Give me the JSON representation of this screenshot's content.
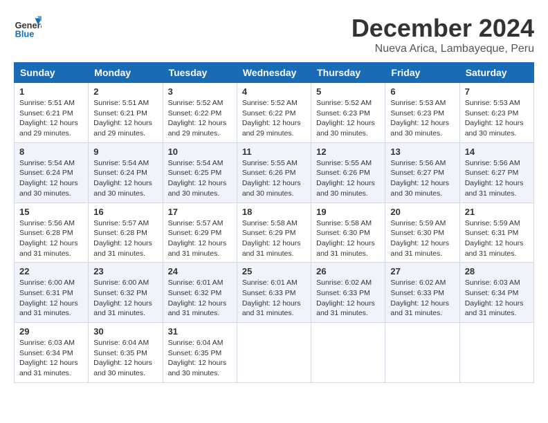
{
  "header": {
    "logo_line1": "General",
    "logo_line2": "Blue",
    "month": "December 2024",
    "location": "Nueva Arica, Lambayeque, Peru"
  },
  "days_of_week": [
    "Sunday",
    "Monday",
    "Tuesday",
    "Wednesday",
    "Thursday",
    "Friday",
    "Saturday"
  ],
  "weeks": [
    [
      {
        "day": 1,
        "sunrise": "5:51 AM",
        "sunset": "6:21 PM",
        "daylight": "12 hours and 29 minutes."
      },
      {
        "day": 2,
        "sunrise": "5:51 AM",
        "sunset": "6:21 PM",
        "daylight": "12 hours and 29 minutes."
      },
      {
        "day": 3,
        "sunrise": "5:52 AM",
        "sunset": "6:22 PM",
        "daylight": "12 hours and 29 minutes."
      },
      {
        "day": 4,
        "sunrise": "5:52 AM",
        "sunset": "6:22 PM",
        "daylight": "12 hours and 29 minutes."
      },
      {
        "day": 5,
        "sunrise": "5:52 AM",
        "sunset": "6:23 PM",
        "daylight": "12 hours and 30 minutes."
      },
      {
        "day": 6,
        "sunrise": "5:53 AM",
        "sunset": "6:23 PM",
        "daylight": "12 hours and 30 minutes."
      },
      {
        "day": 7,
        "sunrise": "5:53 AM",
        "sunset": "6:23 PM",
        "daylight": "12 hours and 30 minutes."
      }
    ],
    [
      {
        "day": 8,
        "sunrise": "5:54 AM",
        "sunset": "6:24 PM",
        "daylight": "12 hours and 30 minutes."
      },
      {
        "day": 9,
        "sunrise": "5:54 AM",
        "sunset": "6:24 PM",
        "daylight": "12 hours and 30 minutes."
      },
      {
        "day": 10,
        "sunrise": "5:54 AM",
        "sunset": "6:25 PM",
        "daylight": "12 hours and 30 minutes."
      },
      {
        "day": 11,
        "sunrise": "5:55 AM",
        "sunset": "6:26 PM",
        "daylight": "12 hours and 30 minutes."
      },
      {
        "day": 12,
        "sunrise": "5:55 AM",
        "sunset": "6:26 PM",
        "daylight": "12 hours and 30 minutes."
      },
      {
        "day": 13,
        "sunrise": "5:56 AM",
        "sunset": "6:27 PM",
        "daylight": "12 hours and 30 minutes."
      },
      {
        "day": 14,
        "sunrise": "5:56 AM",
        "sunset": "6:27 PM",
        "daylight": "12 hours and 31 minutes."
      }
    ],
    [
      {
        "day": 15,
        "sunrise": "5:56 AM",
        "sunset": "6:28 PM",
        "daylight": "12 hours and 31 minutes."
      },
      {
        "day": 16,
        "sunrise": "5:57 AM",
        "sunset": "6:28 PM",
        "daylight": "12 hours and 31 minutes."
      },
      {
        "day": 17,
        "sunrise": "5:57 AM",
        "sunset": "6:29 PM",
        "daylight": "12 hours and 31 minutes."
      },
      {
        "day": 18,
        "sunrise": "5:58 AM",
        "sunset": "6:29 PM",
        "daylight": "12 hours and 31 minutes."
      },
      {
        "day": 19,
        "sunrise": "5:58 AM",
        "sunset": "6:30 PM",
        "daylight": "12 hours and 31 minutes."
      },
      {
        "day": 20,
        "sunrise": "5:59 AM",
        "sunset": "6:30 PM",
        "daylight": "12 hours and 31 minutes."
      },
      {
        "day": 21,
        "sunrise": "5:59 AM",
        "sunset": "6:31 PM",
        "daylight": "12 hours and 31 minutes."
      }
    ],
    [
      {
        "day": 22,
        "sunrise": "6:00 AM",
        "sunset": "6:31 PM",
        "daylight": "12 hours and 31 minutes."
      },
      {
        "day": 23,
        "sunrise": "6:00 AM",
        "sunset": "6:32 PM",
        "daylight": "12 hours and 31 minutes."
      },
      {
        "day": 24,
        "sunrise": "6:01 AM",
        "sunset": "6:32 PM",
        "daylight": "12 hours and 31 minutes."
      },
      {
        "day": 25,
        "sunrise": "6:01 AM",
        "sunset": "6:33 PM",
        "daylight": "12 hours and 31 minutes."
      },
      {
        "day": 26,
        "sunrise": "6:02 AM",
        "sunset": "6:33 PM",
        "daylight": "12 hours and 31 minutes."
      },
      {
        "day": 27,
        "sunrise": "6:02 AM",
        "sunset": "6:33 PM",
        "daylight": "12 hours and 31 minutes."
      },
      {
        "day": 28,
        "sunrise": "6:03 AM",
        "sunset": "6:34 PM",
        "daylight": "12 hours and 31 minutes."
      }
    ],
    [
      {
        "day": 29,
        "sunrise": "6:03 AM",
        "sunset": "6:34 PM",
        "daylight": "12 hours and 31 minutes."
      },
      {
        "day": 30,
        "sunrise": "6:04 AM",
        "sunset": "6:35 PM",
        "daylight": "12 hours and 30 minutes."
      },
      {
        "day": 31,
        "sunrise": "6:04 AM",
        "sunset": "6:35 PM",
        "daylight": "12 hours and 30 minutes."
      },
      null,
      null,
      null,
      null
    ]
  ]
}
